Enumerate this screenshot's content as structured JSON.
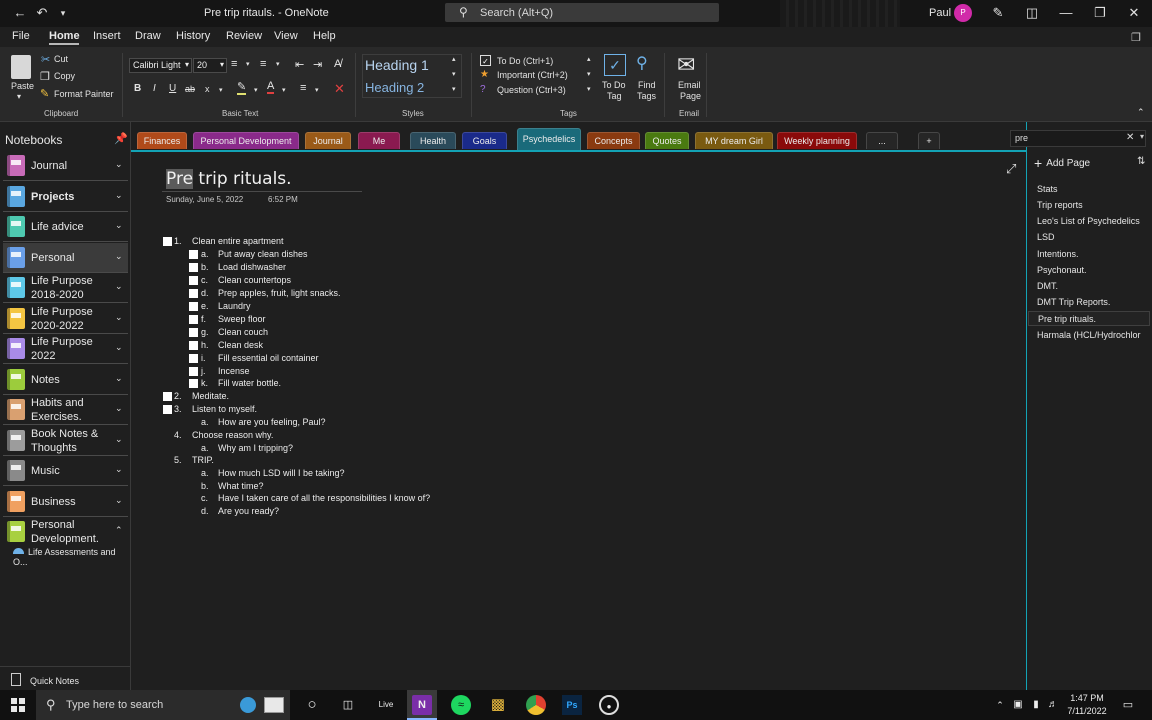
{
  "window": {
    "title": "Pre trip ritauls.  -  OneNote",
    "search_placeholder": "Search (Alt+Q)",
    "user_name": "Paul",
    "avatar_initial": "P"
  },
  "menu": [
    "File",
    "Home",
    "Insert",
    "Draw",
    "History",
    "Review",
    "View",
    "Help"
  ],
  "ribbon": {
    "clipboard": {
      "paste": "Paste",
      "cut": "Cut",
      "copy": "Copy",
      "format_painter": "Format Painter",
      "group": "Clipboard"
    },
    "basic_text": {
      "font": "Calibri Light",
      "size": "20",
      "bold": "B",
      "italic": "I",
      "underline": "U",
      "strike": "ab",
      "subscript": "x",
      "group": "Basic Text"
    },
    "styles": {
      "heading1": "Heading 1",
      "heading2": "Heading 2",
      "group": "Styles"
    },
    "tags": {
      "todo": "To Do (Ctrl+1)",
      "important": "Important (Ctrl+2)",
      "question": "Question (Ctrl+3)",
      "todo_tag_1": "To Do",
      "todo_tag_2": "Tag",
      "find_tags_1": "Find",
      "find_tags_2": "Tags",
      "group": "Tags"
    },
    "email": {
      "label_1": "Email",
      "label_2": "Page",
      "group": "Email"
    }
  },
  "notebooks": {
    "header": "Notebooks",
    "items": [
      {
        "label": "Journal",
        "color": "#c86bb8"
      },
      {
        "label": "Projects",
        "color": "#5aa7e0"
      },
      {
        "label": "Life advice",
        "color": "#4ec9b0"
      },
      {
        "label": "Personal",
        "color": "#6a9fe8"
      },
      {
        "label": "Life Purpose\n2018-2020",
        "color": "#5ec8e8"
      },
      {
        "label": "Life Purpose\n2020-2022",
        "color": "#f4c542"
      },
      {
        "label": "Life Purpose\n2022",
        "color": "#a98be8"
      },
      {
        "label": "Notes",
        "color": "#9ccc3c"
      },
      {
        "label": "Habits and\nExercises.",
        "color": "#d9a070"
      },
      {
        "label": "Book Notes &\nThoughts",
        "color": "#9c9c9c"
      },
      {
        "label": "Music",
        "color": "#8a8a8a"
      },
      {
        "label": "Business",
        "color": "#f0a060"
      },
      {
        "label": "Personal\nDevelopment.",
        "color": "#a8d040"
      }
    ],
    "sub_section": "Life Assessments and O...",
    "quick_notes": "Quick Notes"
  },
  "sections": [
    {
      "label": "Finances",
      "color": "#b04a1a"
    },
    {
      "label": "Personal Development",
      "color": "#8a2a8a"
    },
    {
      "label": "Journal",
      "color": "#9a5a18"
    },
    {
      "label": "Me",
      "color": "#8a1a50"
    },
    {
      "label": "Health",
      "color": "#2a4a5a"
    },
    {
      "label": "Goals",
      "color": "#1a2a8a"
    },
    {
      "label": "Psychedelics",
      "color": "#1a6a7a"
    },
    {
      "label": "Concepts",
      "color": "#8a3a10"
    },
    {
      "label": "Quotes",
      "color": "#4a7a10"
    },
    {
      "label": "MY dream Girl",
      "color": "#7a5a10"
    },
    {
      "label": "Weekly planning",
      "color": "#8a0a0a"
    },
    {
      "label": "...",
      "color": "#262626"
    },
    {
      "label": "+",
      "color": "#262626"
    }
  ],
  "page": {
    "title_highlight": "Pre",
    "title_rest": " trip rituals.",
    "date": "Sunday, June 5, 2022",
    "time": "6:52 PM",
    "items": [
      {
        "num": "1.",
        "text": "Clean entire apartment",
        "cb": true
      },
      {
        "num": "a.",
        "text": "Put away clean dishes",
        "cb": true
      },
      {
        "num": "b.",
        "text": "Load dishwasher",
        "cb": true
      },
      {
        "num": "c.",
        "text": "Clean countertops",
        "cb": true
      },
      {
        "num": "d.",
        "text": "Prep apples, fruit, light snacks.",
        "cb": true
      },
      {
        "num": "e.",
        "text": "Laundry",
        "cb": true
      },
      {
        "num": "f.",
        "text": "Sweep floor",
        "cb": true
      },
      {
        "num": "g.",
        "text": "Clean couch",
        "cb": true
      },
      {
        "num": "h.",
        "text": "Clean desk",
        "cb": true
      },
      {
        "num": "i.",
        "text": "Fill essential oil container",
        "cb": true
      },
      {
        "num": "j.",
        "text": "Incense",
        "cb": true
      },
      {
        "num": "k.",
        "text": "Fill water bottle.",
        "cb": true
      },
      {
        "num": "2.",
        "text": "Meditate.",
        "cb": true
      },
      {
        "num": "3.",
        "text": "Listen to myself.",
        "cb": true
      },
      {
        "num": "a.",
        "text": "How are you feeling, Paul?",
        "cb": false
      },
      {
        "num": "4.",
        "text": "Choose reason why.",
        "cb": false
      },
      {
        "num": "a.",
        "text": "Why am I tripping?",
        "cb": false
      },
      {
        "num": "5.",
        "text": "TRIP.",
        "cb": false
      },
      {
        "num": "a.",
        "text": "How much LSD will I be taking?",
        "cb": false
      },
      {
        "num": "b.",
        "text": "What time?",
        "cb": false
      },
      {
        "num": "c.",
        "text": "Have I taken care of all the responsibilities I know of?",
        "cb": false
      },
      {
        "num": "d.",
        "text": "Are you ready?",
        "cb": false
      }
    ]
  },
  "pages": {
    "search_value": "pre",
    "add_page": "Add Page",
    "items": [
      "Stats",
      "Trip reports",
      "Leo's List of Psychedelics",
      "LSD",
      "Intentions.",
      "Psychonaut.",
      "DMT.",
      "DMT Trip Reports.",
      "Pre trip rituals.",
      "Harmala (HCL/Hydrochlor"
    ]
  },
  "taskbar": {
    "search_placeholder": "Type here to search",
    "live_label": "Live",
    "time": "1:47 PM",
    "date": "7/11/2022"
  }
}
